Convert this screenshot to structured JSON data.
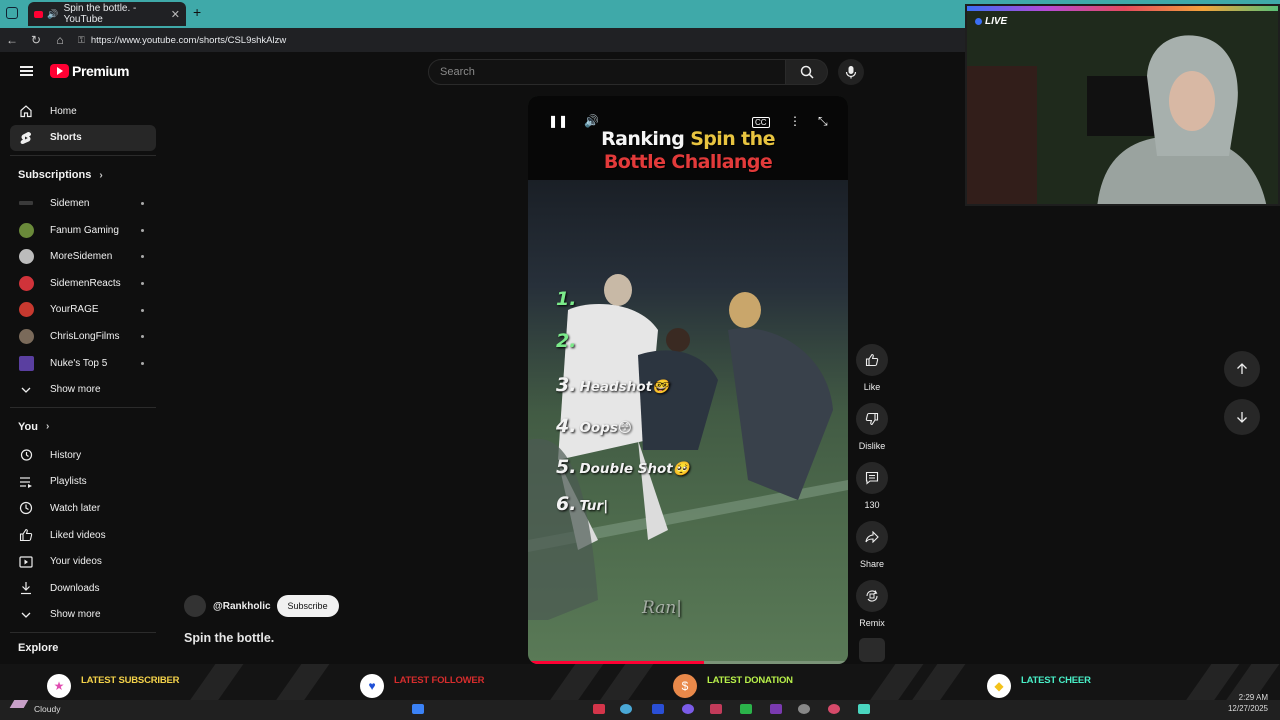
{
  "browser": {
    "tab_title": "Spin the bottle. - YouTube",
    "url": "https://www.youtube.com/shorts/CSL9shkAlzw"
  },
  "youtube": {
    "logo_text": "Premium",
    "search_placeholder": "Search"
  },
  "sidebar": {
    "main": [
      {
        "label": "Home",
        "icon": "home-icon"
      },
      {
        "label": "Shorts",
        "icon": "shorts-icon",
        "active": true
      }
    ],
    "subscriptions_heading": "Subscriptions",
    "subscriptions": [
      {
        "label": "Sidemen",
        "color": "#3a3a3a"
      },
      {
        "label": "Fanum Gaming",
        "color": "#6a8a3a"
      },
      {
        "label": "MoreSidemen",
        "color": "#bcbcbc"
      },
      {
        "label": "SidemenReacts",
        "color": "#d0333a"
      },
      {
        "label": "YourRAGE",
        "color": "#c7392f"
      },
      {
        "label": "ChrisLongFilms",
        "color": "#7a6a5a"
      },
      {
        "label": "Nuke's Top 5",
        "color": "#5a3fa0"
      }
    ],
    "show_more_1": "Show more",
    "you_heading": "You",
    "you_items": [
      {
        "label": "History",
        "icon": "history-icon"
      },
      {
        "label": "Playlists",
        "icon": "playlists-icon"
      },
      {
        "label": "Watch later",
        "icon": "watch-later-icon"
      },
      {
        "label": "Liked videos",
        "icon": "thumbs-up-icon"
      },
      {
        "label": "Your videos",
        "icon": "your-videos-icon"
      },
      {
        "label": "Downloads",
        "icon": "download-icon"
      }
    ],
    "show_more_2": "Show more",
    "explore_heading": "Explore"
  },
  "short": {
    "title_line1_white": "Ranking ",
    "title_line1_gold": "Spin the",
    "title_line2": "Bottle Challange",
    "list": [
      {
        "num": "1.",
        "text": "",
        "num_color": "#7bea8a"
      },
      {
        "num": "2.",
        "text": "",
        "num_color": "#7bea8a"
      },
      {
        "num": "3.",
        "text": "Headshot🤓",
        "num_color": "#ffffff"
      },
      {
        "num": "4.",
        "text": "Oops😳",
        "num_color": "#ffffff"
      },
      {
        "num": "5.",
        "text": "Double Shot🥺",
        "num_color": "#ffffff"
      },
      {
        "num": "6.",
        "text": "Tur|",
        "num_color": "#ffffff"
      }
    ],
    "watermark": "Ran|",
    "progress": 0.55,
    "channel": "@Rankholic",
    "subscribe_label": "Subscribe",
    "video_title": "Spin the bottle."
  },
  "actions": {
    "like": "Like",
    "dislike": "Dislike",
    "comments": "130",
    "share": "Share",
    "remix": "Remix"
  },
  "stream": {
    "live_label": "LIVE",
    "alerts": [
      {
        "label": "LATEST SUBSCRIBER",
        "color": "#f4d24a",
        "icon": "star-icon"
      },
      {
        "label": "LATEST FOLLOWER",
        "color": "#d62d2d",
        "icon": "heart-icon"
      },
      {
        "label": "LATEST DONATION",
        "color": "#b8f04a",
        "icon": "dollar-icon"
      },
      {
        "label": "LATEST CHEER",
        "color": "#49f0c8",
        "icon": "diamond-icon"
      }
    ]
  },
  "taskbar": {
    "weather": "Cloudy",
    "time": "2:29 AM",
    "date": "12/27/2025"
  }
}
